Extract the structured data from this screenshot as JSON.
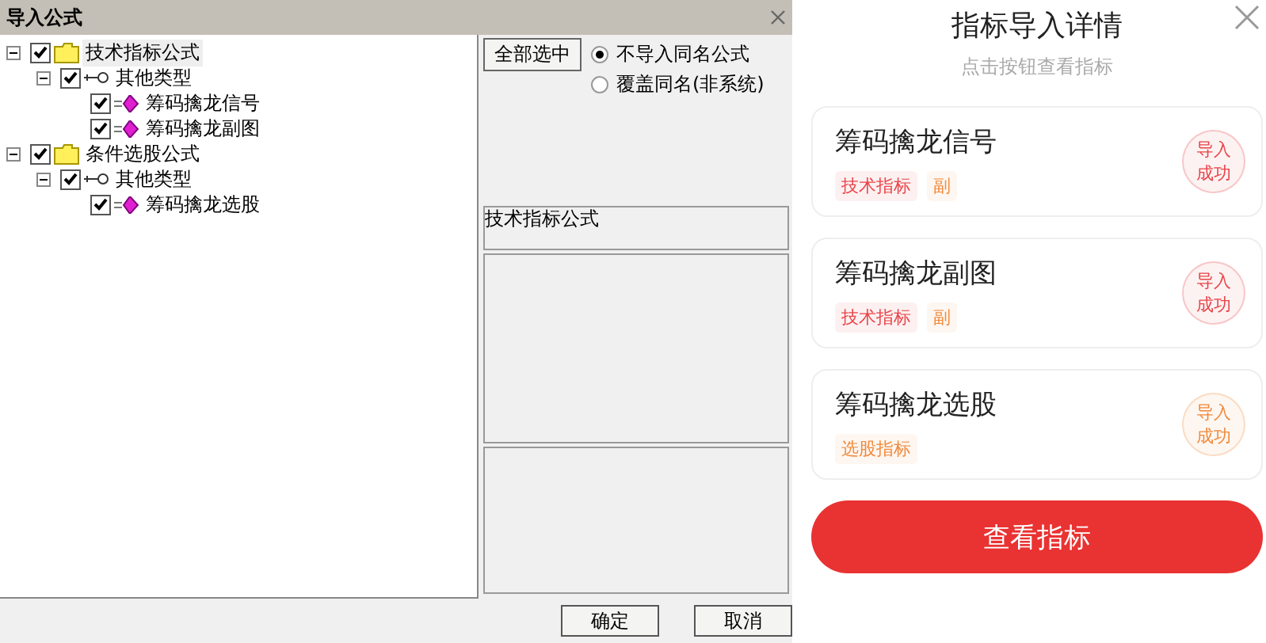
{
  "dialog": {
    "title": "导入公式",
    "tree": [
      {
        "kind": "folder",
        "label": "技术指标公式",
        "checked": true,
        "expanded": true,
        "selected": true,
        "children": [
          {
            "kind": "type",
            "label": "其他类型",
            "checked": true,
            "expanded": true,
            "selected": false,
            "children": [
              {
                "kind": "formula",
                "label": "筹码擒龙信号",
                "checked": true,
                "selected": false
              },
              {
                "kind": "formula",
                "label": "筹码擒龙副图",
                "checked": true,
                "selected": false
              }
            ]
          }
        ]
      },
      {
        "kind": "folder",
        "label": "条件选股公式",
        "checked": true,
        "expanded": true,
        "selected": false,
        "children": [
          {
            "kind": "type",
            "label": "其他类型",
            "checked": true,
            "expanded": true,
            "selected": false,
            "children": [
              {
                "kind": "formula",
                "label": "筹码擒龙选股",
                "checked": true,
                "selected": false
              }
            ]
          }
        ]
      }
    ],
    "select_all_button": "全部选中",
    "options": [
      {
        "label": "不导入同名公式",
        "selected": true
      },
      {
        "label": "覆盖同名(非系统)",
        "selected": false
      }
    ],
    "category_label": "技术指标公式",
    "buttons": [
      "确定",
      "取消"
    ]
  },
  "panel": {
    "title": "指标导入详情",
    "subtitle": "点击按钮查看指标",
    "items": [
      {
        "name": "筹码擒龙信号",
        "tags": [
          {
            "label": "技术指标",
            "color": "#e8454a"
          },
          {
            "label": "副",
            "color": "#f08a3c"
          }
        ],
        "status": "导入成功",
        "color": "#e8454a"
      },
      {
        "name": "筹码擒龙副图",
        "tags": [
          {
            "label": "技术指标",
            "color": "#e8454a"
          },
          {
            "label": "副",
            "color": "#f08a3c"
          }
        ],
        "status": "导入成功",
        "color": "#e8454a"
      },
      {
        "name": "筹码擒龙选股",
        "tags": [
          {
            "label": "选股指标",
            "color": "#f08a3c"
          }
        ],
        "status": "导入成功",
        "color": "#f08a3c"
      }
    ],
    "view_button": "查看指标"
  }
}
